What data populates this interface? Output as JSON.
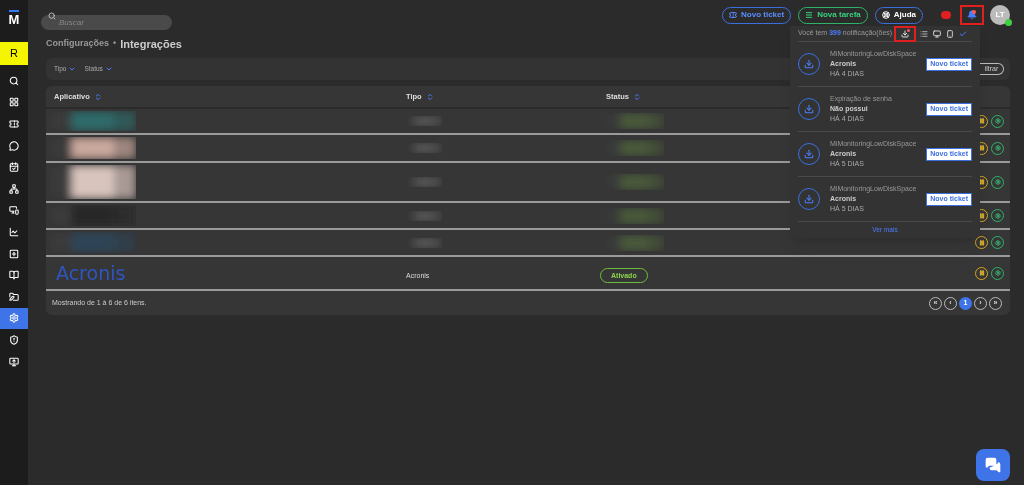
{
  "sidebar": {
    "logo": "M",
    "user_initial": "R",
    "items": [
      {
        "selected": false
      },
      {
        "selected": false
      },
      {
        "selected": false
      },
      {
        "selected": false
      },
      {
        "selected": false
      },
      {
        "selected": false
      },
      {
        "selected": false
      },
      {
        "selected": false
      },
      {
        "selected": false
      },
      {
        "selected": false
      },
      {
        "selected": false
      },
      {
        "selected": true
      },
      {
        "selected": false
      },
      {
        "selected": false
      }
    ]
  },
  "header": {
    "search_placeholder": "Buscar",
    "buttons": [
      {
        "label": "Novo ticket",
        "kind": "ticket"
      },
      {
        "label": "Nova tarefa",
        "kind": "task"
      },
      {
        "label": "Ajuda",
        "kind": "help"
      }
    ],
    "avatar": "LT"
  },
  "breadcrumb": {
    "parent": "Configurações",
    "separator": "•",
    "current": "Integrações"
  },
  "filters": [
    {
      "label": "Tipo"
    },
    {
      "label": "Status"
    }
  ],
  "filter_button": "iltrar",
  "table": {
    "columns": [
      "Aplicativo",
      "Tipo",
      "Status"
    ],
    "rows": [
      {
        "kind": "picture"
      },
      {
        "kind": "picture"
      },
      {
        "kind": "picture"
      },
      {
        "kind": "picture"
      },
      {
        "kind": "picture"
      },
      {
        "kind": "app",
        "logo": "Acronis",
        "type": "Acronis",
        "status": "Ativado"
      }
    ],
    "footer": "Mostrando de 1 à 6 de 6 itens.",
    "pages": [
      {
        "label": "«",
        "selected": false
      },
      {
        "label": "‹",
        "selected": false
      },
      {
        "label": "1",
        "selected": true
      },
      {
        "label": "›",
        "selected": false
      },
      {
        "label": "»",
        "selected": false
      }
    ]
  },
  "notifications": {
    "prefix": "Você tem",
    "count": "399",
    "suffix": "notificação(ões)",
    "items": [
      {
        "title": "MiMonitoringLowDiskSpace",
        "subtitle": "Acronis",
        "time": "HÁ 4 DIAS",
        "action": "Novo ticket"
      },
      {
        "title": "Expiração de senha",
        "subtitle": "Não possui",
        "time": "HÁ 4 DIAS",
        "action": "Novo ticket"
      },
      {
        "title": "MiMonitoringLowDiskSpace",
        "subtitle": "Acronis",
        "time": "HÁ 5 DIAS",
        "action": "Novo ticket"
      },
      {
        "title": "MiMonitoringLowDiskSpace",
        "subtitle": "Acronis",
        "time": "HÁ 5 DIAS",
        "action": "Novo ticket"
      }
    ],
    "more": "Ver mais"
  }
}
